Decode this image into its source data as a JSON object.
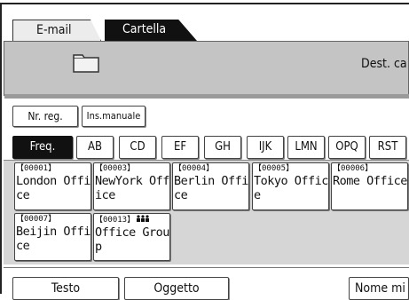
{
  "tabs": [
    {
      "label": "E-mail",
      "active": false
    },
    {
      "label": "Cartella",
      "active": true
    }
  ],
  "header": {
    "folder_icon": "folder-icon",
    "dest_label": "Dest. ca"
  },
  "buttons": {
    "nr_reg": "Nr. reg.",
    "ins_manuale": "Ins.manuale"
  },
  "letter_tabs": [
    "Freq.",
    "AB",
    "CD",
    "EF",
    "GH",
    "IJK",
    "LMN",
    "OPQ",
    "RST"
  ],
  "entries": [
    {
      "num": "【00001】",
      "name": "London Office"
    },
    {
      "num": "【00003】",
      "name": "NewYork Office"
    },
    {
      "num": "【00004】",
      "name": "Berlin Office"
    },
    {
      "num": "【00005】",
      "name": "Tokyo Office"
    },
    {
      "num": "【00006】",
      "name": "Rome Office"
    },
    {
      "num": "【00007】",
      "name": "Beijin Office"
    },
    {
      "num": "【00013】",
      "name": "Office Group",
      "group_icon": "group-icon"
    }
  ],
  "bottom": {
    "testo": "Testo",
    "oggetto": "Oggetto",
    "nome_mittente": "Nome mi"
  },
  "colors": {
    "active_tab": "#111111",
    "panel": "#c4c4c4",
    "list_bg": "#d6d6d6"
  }
}
